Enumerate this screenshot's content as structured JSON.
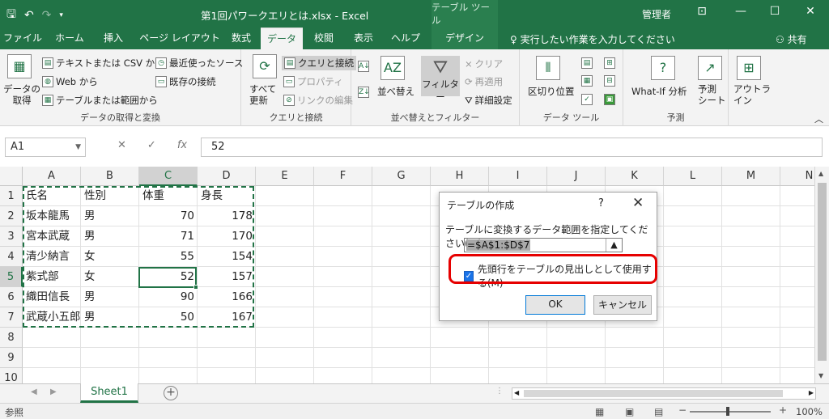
{
  "titlebar": {
    "title": "第1回パワークエリとは.xlsx - Excel",
    "contextual": "テーブル ツール",
    "user": "管理者",
    "qat": {
      "save_icon": "save-icon",
      "undo_icon": "undo-icon",
      "redo_icon": "redo-icon"
    }
  },
  "tabs": {
    "file": "ファイル",
    "home": "ホーム",
    "insert": "挿入",
    "layout": "ページ レイアウト",
    "formulas": "数式",
    "data": "データ",
    "review": "校閲",
    "view": "表示",
    "help": "ヘルプ",
    "design": "デザイン",
    "tellme": "実行したい作業を入力してください",
    "share": "共有"
  },
  "ribbon": {
    "get_data": "データの\n取得",
    "from_text": "テキストまたは CSV から",
    "from_web": "Web から",
    "from_table": "テーブルまたは範囲から",
    "recent": "最近使ったソース",
    "existing": "既存の接続",
    "group1": "データの取得と変換",
    "refresh_all": "すべて\n更新",
    "queries": "クエリと接続",
    "properties": "プロパティ",
    "edit_links": "リンクの編集",
    "group2": "クエリと接続",
    "sort": "並べ替え",
    "filter": "フィルター",
    "clear": "クリア",
    "reapply": "再適用",
    "advanced": "詳細設定",
    "group3": "並べ替えとフィルター",
    "text_to_columns": "区切り位置",
    "group4": "データ ツール",
    "whatif": "What-If 分析",
    "forecast": "予測\nシート",
    "group5": "予測",
    "outline": "アウトラ\nイン"
  },
  "formula_bar": {
    "name_box": "A1",
    "value": "52",
    "fx": "fx"
  },
  "grid": {
    "columns": [
      "A",
      "B",
      "C",
      "D",
      "E",
      "F",
      "G",
      "H",
      "I",
      "J",
      "K",
      "L",
      "M",
      "N"
    ],
    "rows": [
      "1",
      "2",
      "3",
      "4",
      "5",
      "6",
      "7",
      "8",
      "9",
      "10"
    ],
    "data": [
      [
        "氏名",
        "性別",
        "体重",
        "身長"
      ],
      [
        "坂本龍馬",
        "男",
        "70",
        "178"
      ],
      [
        "宮本武蔵",
        "男",
        "71",
        "170"
      ],
      [
        "清少納言",
        "女",
        "55",
        "154"
      ],
      [
        "紫式部",
        "女",
        "52",
        "157"
      ],
      [
        "織田信長",
        "男",
        "90",
        "166"
      ],
      [
        "武蔵小五郎",
        "男",
        "50",
        "167"
      ]
    ]
  },
  "sheet": {
    "tab": "Sheet1",
    "add": "+"
  },
  "status": {
    "mode": "参照",
    "zoom": "100%"
  },
  "dialog": {
    "title": "テーブルの作成",
    "help": "?",
    "close": "✕",
    "prompt": "テーブルに変換するデータ範囲を指定してください(W)",
    "range": "=$A$1:$D$7",
    "checkbox_label": "先頭行をテーブルの見出しとして使用する(M)",
    "checkbox_checked": true,
    "ok": "OK",
    "cancel": "キャンセル"
  },
  "colors": {
    "accent": "#217346",
    "highlight": "#e60000",
    "checkbox": "#1a73e8"
  }
}
